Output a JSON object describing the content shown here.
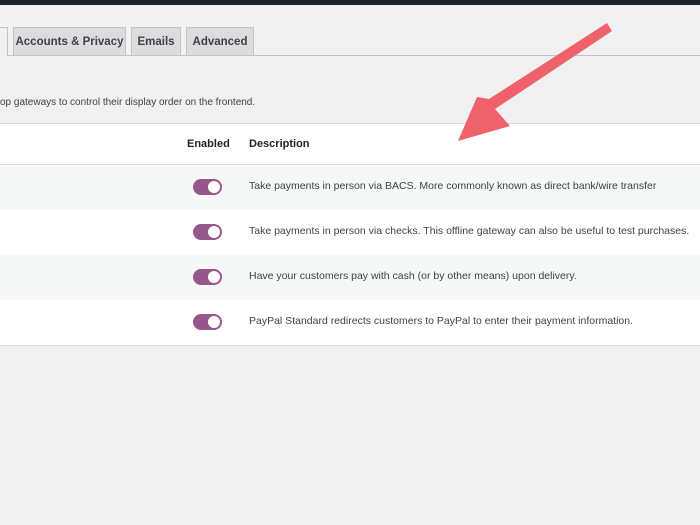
{
  "tabs": [
    {
      "label": ""
    },
    {
      "label": "Accounts & Privacy"
    },
    {
      "label": "Emails"
    },
    {
      "label": "Advanced"
    }
  ],
  "intro_text": "op gateways to control their display order on the frontend.",
  "table": {
    "headers": {
      "enabled": "Enabled",
      "description": "Description"
    },
    "rows": [
      {
        "enabled": true,
        "description": "Take payments in person via BACS. More commonly known as direct bank/wire transfer"
      },
      {
        "enabled": true,
        "description": "Take payments in person via checks. This offline gateway can also be useful to test purchases."
      },
      {
        "enabled": true,
        "description": "Have your customers pay with cash (or by other means) upon delivery."
      },
      {
        "enabled": true,
        "description": "PayPal Standard redirects customers to PayPal to enter their payment information."
      }
    ]
  },
  "colors": {
    "toggle_on": "#96588a",
    "arrow": "#f0626b",
    "admin_bar": "#1d2327"
  }
}
